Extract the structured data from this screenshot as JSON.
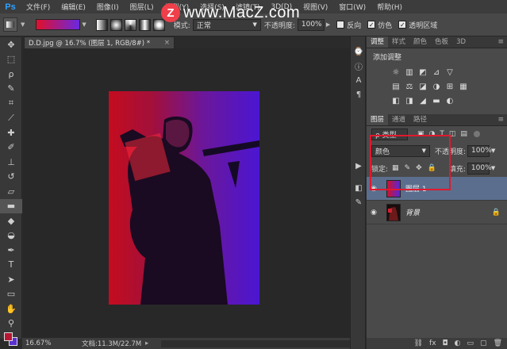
{
  "app": {
    "logo": "Ps"
  },
  "menu": {
    "items": [
      "文件(F)",
      "编辑(E)",
      "图像(I)",
      "图层(L)",
      "类型(Y)",
      "选择(S)",
      "滤镜(T)",
      "3D(D)",
      "视图(V)",
      "窗口(W)",
      "帮助(H)"
    ]
  },
  "watermark": {
    "badge": "Z",
    "text": "www.MacZ.com"
  },
  "options": {
    "gradient_colors": [
      "#e0102c",
      "#6a28e0"
    ],
    "mode_label": "模式:",
    "mode_value": "正常",
    "opacity_label": "不透明度:",
    "opacity_value": "100%",
    "reverse_label": "反向",
    "dither_label": "仿色",
    "transparency_label": "透明区域",
    "dither_checked": true,
    "transparency_checked": true,
    "reverse_checked": false
  },
  "document": {
    "tab_title": "D.D.jpg @ 16.7% (图层 1, RGB/8#) *",
    "close": "×"
  },
  "status": {
    "zoom": "16.67%",
    "doc_info": "文档:11.3M/22.7M",
    "arrow": "▸"
  },
  "adjustments": {
    "tabs": [
      "调整",
      "样式",
      "颜色",
      "色板",
      "3D"
    ],
    "title": "添加调整",
    "row1": [
      "☼",
      "▥",
      "◩",
      "⊿",
      "▽"
    ],
    "row2": [
      "▤",
      "⚖",
      "◪",
      "◑",
      "⊞",
      "▦"
    ],
    "row3": [
      "◧",
      "◨",
      "◢",
      "▬",
      "◐"
    ]
  },
  "layers": {
    "tabs": [
      "图层",
      "通道",
      "路径"
    ],
    "filter_label": "ρ 类型",
    "blend_mode": "颜色",
    "opacity_label": "不透明度:",
    "opacity_value": "100%",
    "lock_label": "锁定:",
    "fill_label": "填充:",
    "fill_value": "100%",
    "items": [
      {
        "name": "图层 1",
        "selected": true
      },
      {
        "name": "背景",
        "locked": true
      }
    ],
    "bottom_icons": [
      "⛓",
      "fx",
      "◘",
      "◐",
      "▭",
      "▢",
      "🗑"
    ]
  },
  "colors": {
    "foreground": "#b81633",
    "background": "#5a2fd0",
    "highlight": "#e0192e"
  }
}
